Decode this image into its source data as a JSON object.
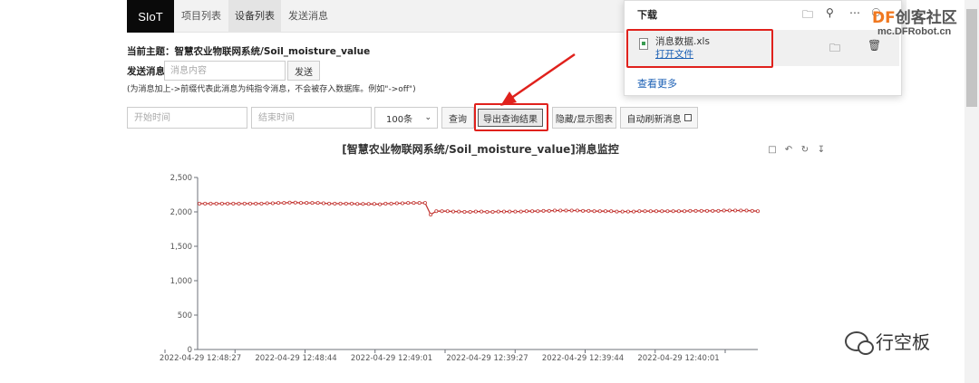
{
  "nav": {
    "brand": "SIoT",
    "tabs": [
      {
        "label": "项目列表"
      },
      {
        "label": "设备列表"
      },
      {
        "label": "发送消息"
      }
    ]
  },
  "topic": "当前主题：智慧农业物联网系统/Soil_moisture_value",
  "send": {
    "label": "发送消息",
    "placeholder": "消息内容",
    "button": "发送",
    "hint": "(为消息加上->前缀代表此消息为纯指令消息，不会被存入数据库。例如\"->off\")"
  },
  "controls": {
    "start_placeholder": "开始时间",
    "end_placeholder": "结束时间",
    "limit": "100条",
    "query": "查询",
    "export": "导出查询结果",
    "toggle_chart": "隐藏/显示图表",
    "auto_refresh": "自动刷新消息"
  },
  "download_panel": {
    "title": "下载",
    "file_name": "消息数据.xls",
    "open_file": "打开文件",
    "see_more": "查看更多"
  },
  "watermark": {
    "brand_df": "DF",
    "brand_rest": "创客社区",
    "url": "mc.DFRobot.cn",
    "bottom": "行空板"
  },
  "colors": {
    "series": "#c23531",
    "highlight": "#e0211c",
    "link": "#1a5fb4"
  },
  "chart_data": {
    "type": "line",
    "title": "[智慧农业物联网系统/Soil_moisture_value]消息监控",
    "ylim": [
      0,
      2500
    ],
    "yticks": [
      0,
      500,
      1000,
      1500,
      2000,
      2500
    ],
    "ytick_labels": [
      "0",
      "500",
      "1,000",
      "1,500",
      "2,000",
      "2,500"
    ],
    "xtick_labels": [
      "2022-04-29 12:48:27",
      "2022-04-29 12:48:44",
      "2022-04-29 12:49:01",
      "2022-04-29 12:39:27",
      "2022-04-29 12:39:44",
      "2022-04-29 12:40:01"
    ],
    "grid": false,
    "series": [
      {
        "values": [
          2120,
          2120,
          2120,
          2120,
          2120,
          2120,
          2120,
          2120,
          2120,
          2120,
          2120,
          2120,
          2125,
          2125,
          2130,
          2130,
          2135,
          2135,
          2130,
          2130,
          2130,
          2130,
          2125,
          2120,
          2120,
          2120,
          2120,
          2120,
          2115,
          2115,
          2115,
          2115,
          2110,
          2120,
          2120,
          2125,
          2125,
          2130,
          2130,
          2130,
          2130,
          1960,
          2010,
          2010,
          2010,
          2005,
          2005,
          2000,
          2000,
          2005,
          2005,
          2000,
          2000,
          2005,
          2005,
          2005,
          2005,
          2005,
          2010,
          2010,
          2010,
          2015,
          2015,
          2020,
          2020,
          2020,
          2020,
          2020,
          2015,
          2015,
          2010,
          2010,
          2010,
          2010,
          2005,
          2005,
          2005,
          2005,
          2010,
          2010,
          2010,
          2010,
          2010,
          2010,
          2010,
          2010,
          2010,
          2015,
          2015,
          2015,
          2015,
          2015,
          2015,
          2020,
          2020,
          2020,
          2020,
          2020,
          2015,
          2010
        ]
      }
    ]
  }
}
